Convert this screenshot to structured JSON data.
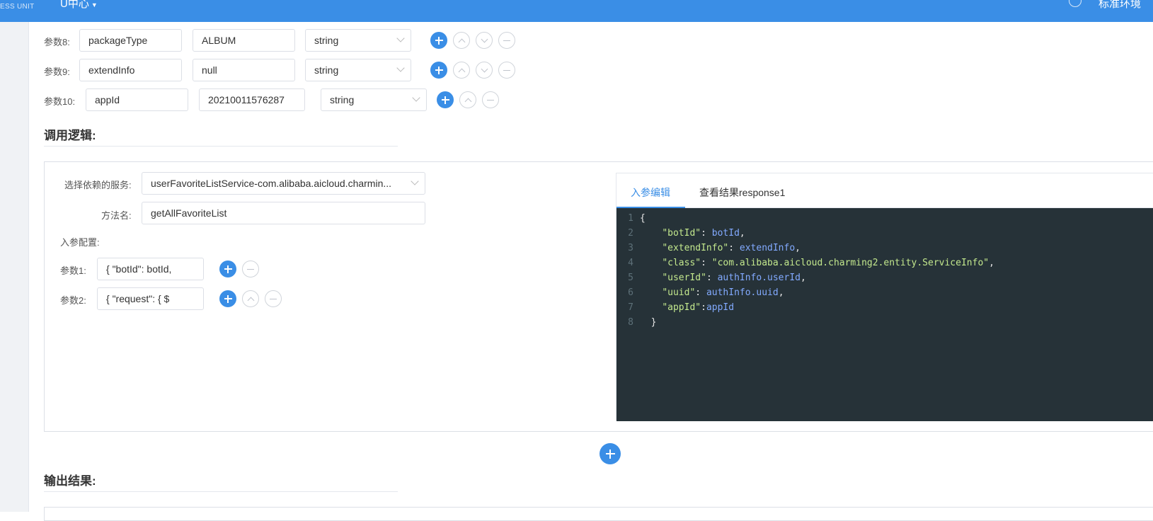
{
  "topbar": {
    "brand_sub": "ESS UNIT",
    "center_menu": "U中心",
    "env_label": "标准环境"
  },
  "params": [
    {
      "label": "参数8:",
      "name": "packageType",
      "value": "ALBUM",
      "type": "string"
    },
    {
      "label": "参数9:",
      "name": "extendInfo",
      "value": "null",
      "type": "string"
    },
    {
      "label": "参数10:",
      "name": "appId",
      "value": "20210011576287",
      "type": "string"
    }
  ],
  "logic": {
    "title": "调用逻辑:",
    "service_label": "选择依赖的服务:",
    "service_value": "userFavoriteListService-com.alibaba.aicloud.charmin...",
    "method_label": "方法名:",
    "method_value": "getAllFavoriteList",
    "input_config_label": "入参配置:",
    "inputs": [
      {
        "label": "参数1:",
        "value": "{    \"botId\": botId,"
      },
      {
        "label": "参数2:",
        "value": "{    \"request\": {      $"
      }
    ]
  },
  "editor": {
    "tabs": [
      {
        "label": "入参编辑",
        "active": true
      },
      {
        "label": "查看结果response1",
        "active": false
      }
    ],
    "lines": [
      {
        "n": "1",
        "text": "{"
      },
      {
        "n": "2",
        "text": "    \"botId\": botId,"
      },
      {
        "n": "3",
        "text": "    \"extendInfo\": extendInfo,"
      },
      {
        "n": "4",
        "text": "    \"class\": \"com.alibaba.aicloud.charming2.entity.ServiceInfo\","
      },
      {
        "n": "5",
        "text": "    \"userId\": authInfo.userId,"
      },
      {
        "n": "6",
        "text": "    \"uuid\": authInfo.uuid,"
      },
      {
        "n": "7",
        "text": "    \"appId\":appId"
      },
      {
        "n": "8",
        "text": "  }"
      }
    ]
  },
  "output": {
    "title": "输出结果:"
  },
  "colors": {
    "primary": "#3a8ee6",
    "editor_bg": "#263238",
    "code_key": "#c3e88d",
    "code_value": "#82aaff"
  }
}
